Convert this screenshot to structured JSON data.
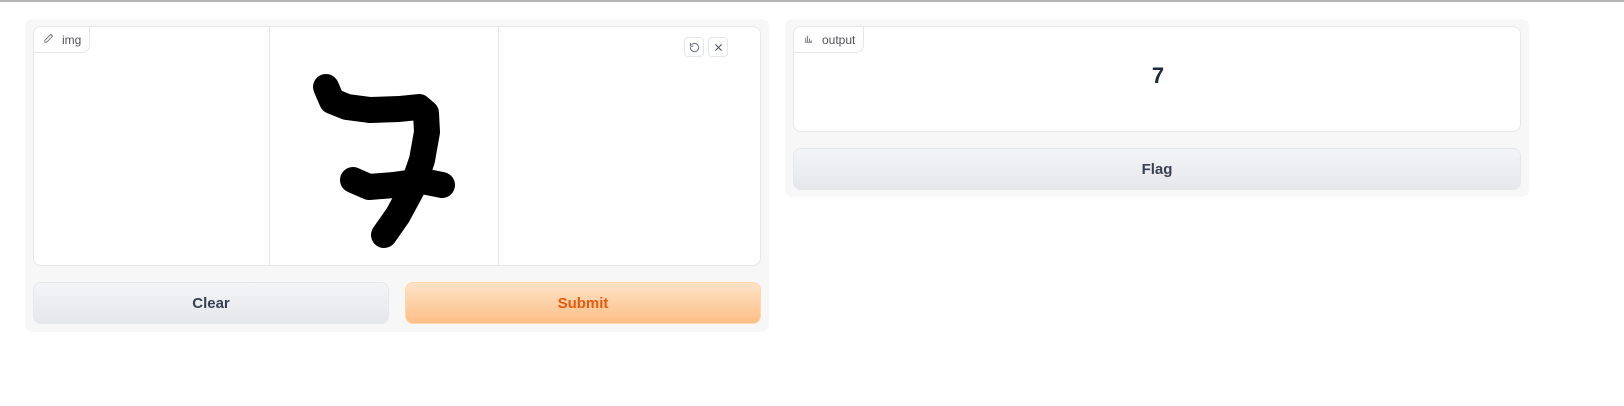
{
  "input": {
    "label": "img",
    "label_icon": "pencil-icon",
    "tools": [
      "undo-icon",
      "close-icon"
    ],
    "drawn_content": "handwritten digit 7"
  },
  "actions": {
    "clear_label": "Clear",
    "submit_label": "Submit"
  },
  "output": {
    "label": "output",
    "label_icon": "bar-chart-icon",
    "value": "7",
    "flag_label": "Flag"
  },
  "colors": {
    "primary_text": "#ea580c",
    "primary_bg": "#fdbf86",
    "border": "#e5e7eb",
    "panel_bg": "#f7f7f8"
  }
}
